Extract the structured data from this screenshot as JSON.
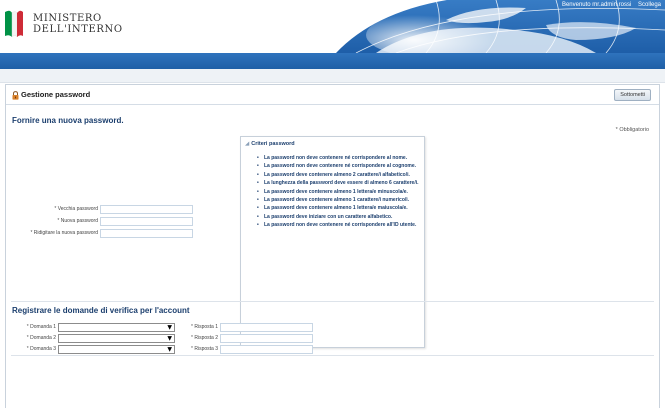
{
  "header": {
    "org_line1": "MINISTERO",
    "org_line2": "DELL'INTERNO",
    "welcome": "Benvenuto mr.admin.rossi",
    "logout": "Scollega"
  },
  "panel": {
    "title": "Gestione password",
    "submit_label": "Sottometti"
  },
  "password_section": {
    "title": "Fornire una nuova password.",
    "required_note": "* Obbligatorio",
    "fields": [
      {
        "label": "Vecchia password",
        "value": ""
      },
      {
        "label": "Nuova password",
        "value": ""
      },
      {
        "label": "Ridigitare la nuova password",
        "value": ""
      }
    ]
  },
  "criteria": {
    "title": "Criteri password",
    "items": [
      "La password non deve contenere né corrispondere al nome.",
      "La password non deve contenere né corrispondere al cognome.",
      "La password deve contenere almeno 2 carattere/i alfabetico/i.",
      "La lunghezza della password deve essere di almeno 6 carattere/i.",
      "La password deve contenere almeno 1 lettera/e minuscola/e.",
      "La password deve contenere almeno 1 carattere/i numerico/i.",
      "La password deve contenere almeno 1 lettera/e maiuscola/e.",
      "La password deve iniziare con un carattere alfabetico.",
      "La password non deve contenere né corrispondere all'ID utente."
    ]
  },
  "security_section": {
    "title": "Registrare le domande di verifica per l'account",
    "rows": [
      {
        "question_label": "Domanda 1",
        "question_value": "",
        "answer_label": "Risposta 1",
        "answer_value": ""
      },
      {
        "question_label": "Domanda 2",
        "question_value": "",
        "answer_label": "Risposta 2",
        "answer_value": ""
      },
      {
        "question_label": "Domanda 3",
        "question_value": "",
        "answer_label": "Risposta 3",
        "answer_value": ""
      }
    ]
  },
  "icons": {
    "lock": "lock-icon",
    "dropdown": "chevron-down-icon",
    "flag": "italian-flag-logo",
    "resize": "resize-icon"
  },
  "colors": {
    "header_blue": "#2f73bd",
    "title_blue": "#1c3f6e",
    "flag_green": "#009246",
    "flag_red": "#ce2b37"
  }
}
